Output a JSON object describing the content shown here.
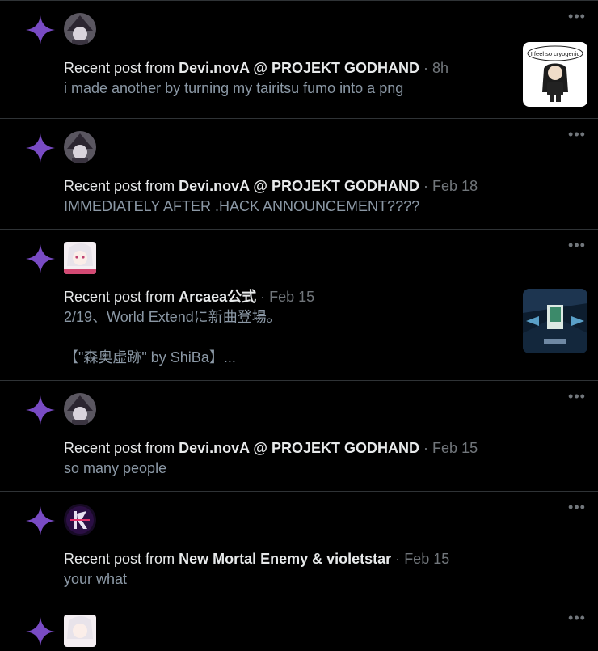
{
  "notifications": [
    {
      "prefix": "Recent post from",
      "author": "Devi.novA @ PROJEKT GODHAND",
      "separator": "·",
      "time": "8h",
      "text": "i made another by turning my tairitsu fumo into a png",
      "thumbnail_caption": "I feel so cryogenic"
    },
    {
      "prefix": "Recent post from",
      "author": "Devi.novA @ PROJEKT GODHAND",
      "separator": "·",
      "time": "Feb 18",
      "text": "IMMEDIATELY AFTER .HACK ANNOUNCEMENT????"
    },
    {
      "prefix": "Recent post from",
      "author": "Arcaea公式",
      "separator": "·",
      "time": "Feb 15",
      "text": "2/19、World Extendに新曲登場。\n\n【\"森奥虚跡\" by ShiBa】..."
    },
    {
      "prefix": "Recent post from",
      "author": "Devi.novA @ PROJEKT GODHAND",
      "separator": "·",
      "time": "Feb 15",
      "text": "so many people"
    },
    {
      "prefix": "Recent post from",
      "author": "New Mortal Enemy & violetstar",
      "separator": "·",
      "time": "Feb 15",
      "text": "your what"
    }
  ],
  "icons": {
    "spark": "purple-sparkle-icon",
    "more": "more-dots-icon"
  },
  "colors": {
    "background": "#000000",
    "accent": "#794BC4",
    "muted": "#71767b",
    "divider": "#2f3336"
  }
}
